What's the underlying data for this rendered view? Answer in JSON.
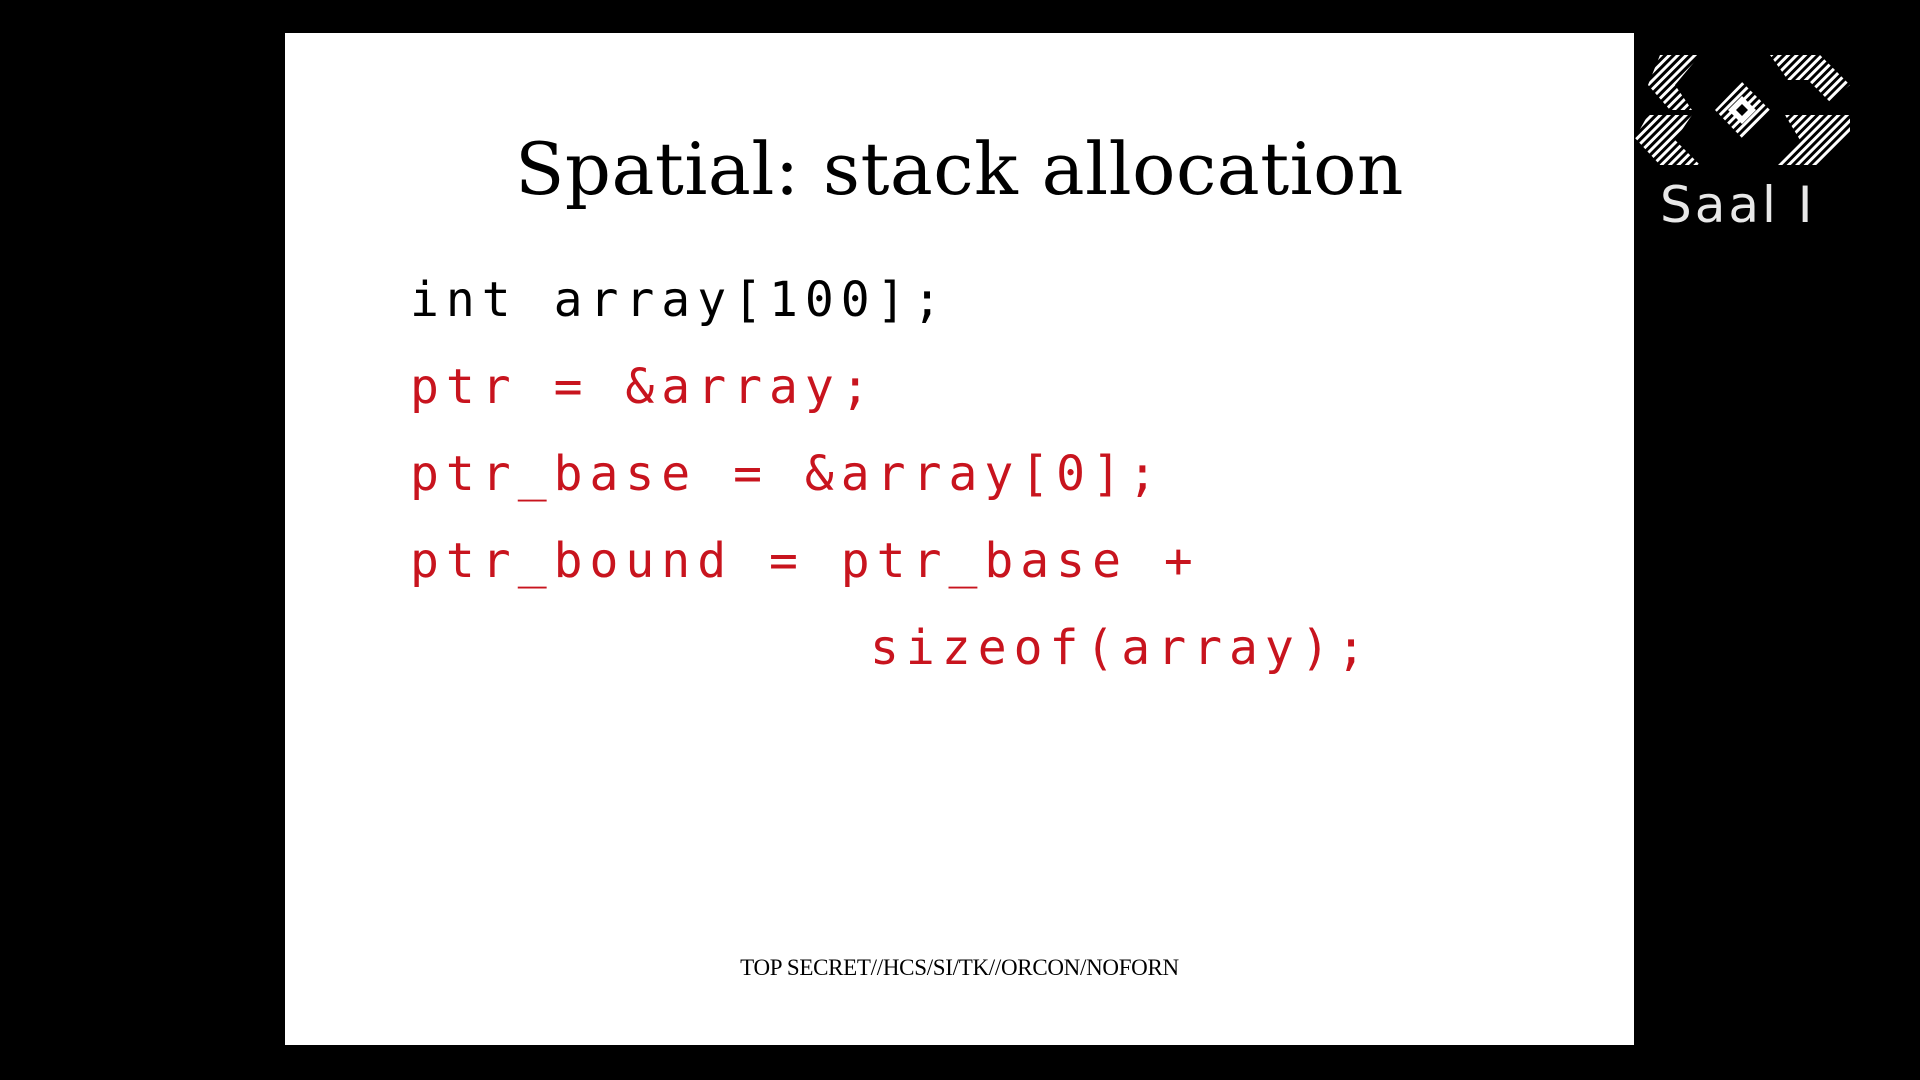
{
  "slide": {
    "title": "Spatial: stack allocation",
    "code_lines": [
      "int array[100];",
      "ptr = &array;",
      "ptr_base = &array[0];",
      "ptr_bound = ptr_base +",
      "sizeof(array);"
    ],
    "footer": "TOP SECRET//HCS/SI/TK//ORCON/NOFORN"
  },
  "overlay": {
    "logo_icon": "congress-logo-icon",
    "room_label": "Saal I"
  },
  "colors": {
    "background": "#000000",
    "slide": "#ffffff",
    "code_default": "#000000",
    "code_highlight": "#c8141e",
    "overlay_text": "#e8e8e8"
  }
}
